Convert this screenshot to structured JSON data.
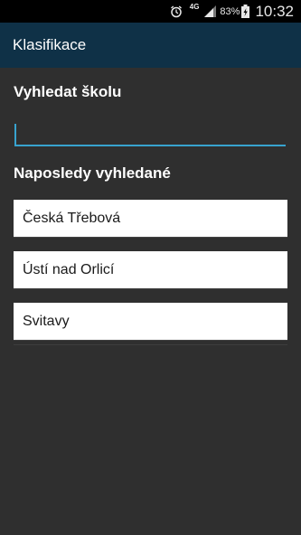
{
  "status_bar": {
    "network": "4G",
    "battery_percent": "83%",
    "time": "10:32",
    "icons": [
      "alarm-icon",
      "signal-icon",
      "battery-charging-icon"
    ]
  },
  "app_bar": {
    "title": "Klasifikace"
  },
  "search": {
    "label": "Vyhledat školu",
    "value": "",
    "placeholder": ""
  },
  "recent": {
    "label": "Naposledy vyhledané",
    "items": [
      "Česká Třebová",
      "Ústí nad Orlicí",
      "Svitavy"
    ]
  },
  "colors": {
    "app_bar": "#0f3147",
    "background": "#2f2f2f",
    "accent": "#38a3cf"
  }
}
